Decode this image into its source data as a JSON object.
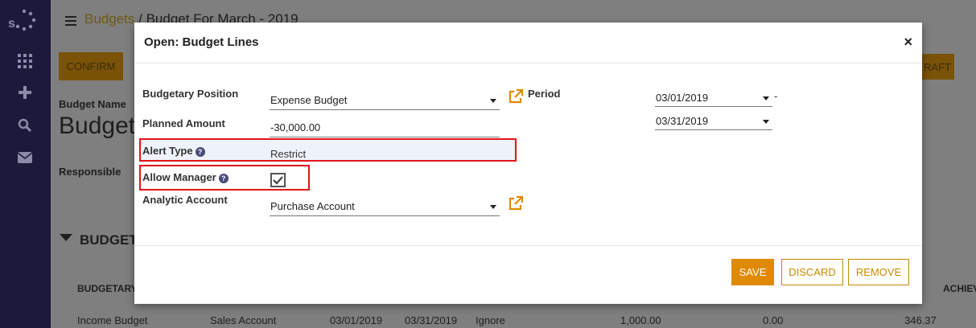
{
  "background": {
    "breadcrumb_root": "Budgets",
    "breadcrumb_sep": "/",
    "breadcrumb_current": "Budget For March - 2019",
    "confirm_label": "CONFIRM",
    "draft_label": "RAFT",
    "budget_name_label": "Budget Name",
    "budget_name_value": "Budget F",
    "responsible_label": "Responsible",
    "section_label": "BUDGET",
    "col_budgetary": "BUDGETARY",
    "col_achievement": "ACHIEV",
    "row": {
      "position": "Income Budget",
      "account": "Sales Account",
      "start": "03/01/2019",
      "end": "03/31/2019",
      "alert": "Ignore",
      "planned": "1,000.00",
      "practical": "0.00",
      "theoretical": "346.37"
    }
  },
  "modal": {
    "title": "Open: Budget Lines",
    "close": "×",
    "fields": {
      "budgetary_position": {
        "label": "Budgetary Position",
        "value": "Expense Budget"
      },
      "planned_amount": {
        "label": "Planned Amount",
        "value": "-30,000.00"
      },
      "alert_type": {
        "label": "Alert Type",
        "value": "Restrict",
        "help": "?"
      },
      "allow_manager": {
        "label": "Allow Manager",
        "checked": true,
        "help": "?"
      },
      "analytic_account": {
        "label": "Analytic Account",
        "value": "Purchase Account"
      },
      "period": {
        "label": "Period",
        "start": "03/01/2019",
        "end": "03/31/2019",
        "separator": "-"
      }
    },
    "buttons": {
      "save": "SAVE",
      "discard": "DISCARD",
      "remove": "REMOVE"
    }
  },
  "colors": {
    "accent": "#e08a00",
    "nav": "#1c1a3b",
    "highlight": "#e0151a"
  }
}
